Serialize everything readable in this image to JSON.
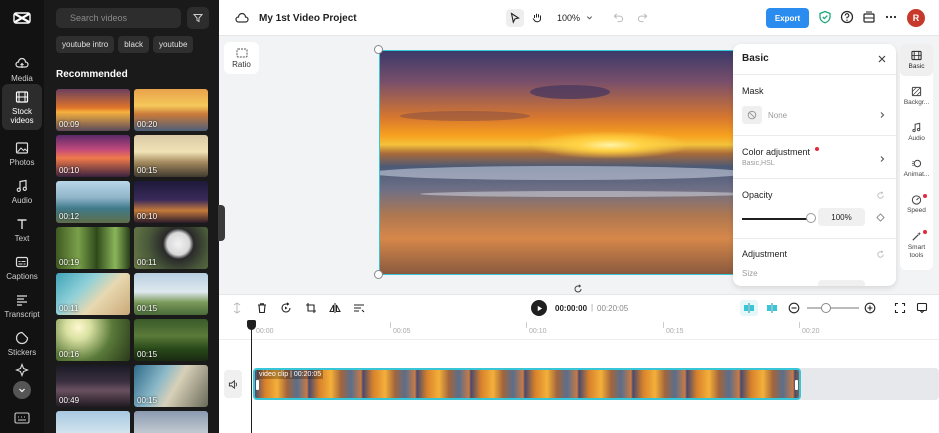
{
  "header": {
    "project_title": "My 1st Video Project",
    "zoom": "100%",
    "export_label": "Export",
    "avatar_initial": "R"
  },
  "rail": {
    "items": [
      {
        "label": "Media",
        "icon": "cloud-upload-icon"
      },
      {
        "label": "Stock videos",
        "icon": "film-icon"
      },
      {
        "label": "Photos",
        "icon": "image-icon"
      },
      {
        "label": "Audio",
        "icon": "music-note-icon"
      },
      {
        "label": "Text",
        "icon": "text-icon"
      },
      {
        "label": "Captions",
        "icon": "captions-icon"
      },
      {
        "label": "Transcript",
        "icon": "transcript-icon"
      },
      {
        "label": "Stickers",
        "icon": "sticker-icon"
      }
    ]
  },
  "media_panel": {
    "search_placeholder": "Search videos",
    "tags": [
      "youtube intro",
      "black",
      "youtube"
    ],
    "recommended_title": "Recommended",
    "thumbnails": [
      {
        "duration": "00:09"
      },
      {
        "duration": "00:20"
      },
      {
        "duration": "00:10"
      },
      {
        "duration": "00:15"
      },
      {
        "duration": "00:12"
      },
      {
        "duration": "00:10"
      },
      {
        "duration": "00:19"
      },
      {
        "duration": "00:11"
      },
      {
        "duration": "00:11"
      },
      {
        "duration": "00:15"
      },
      {
        "duration": "00:16"
      },
      {
        "duration": "00:15"
      },
      {
        "duration": "00:49"
      },
      {
        "duration": "00:15"
      },
      {
        "duration": ""
      },
      {
        "duration": ""
      }
    ]
  },
  "canvas": {
    "ratio_label": "Ratio"
  },
  "properties": {
    "title": "Basic",
    "mask_label": "Mask",
    "mask_value": "None",
    "color_label": "Color adjustment",
    "color_sub": "Basic,HSL",
    "opacity_label": "Opacity",
    "opacity_value": "100%",
    "opacity_fraction": 1.0,
    "adjustment_label": "Adjustment",
    "size_label": "Size"
  },
  "right_tools": [
    {
      "label": "Basic"
    },
    {
      "label": "Backgr..."
    },
    {
      "label": "Audio"
    },
    {
      "label": "Animat..."
    },
    {
      "label": "Speed"
    },
    {
      "label": "Smart tools"
    }
  ],
  "timeline": {
    "current_time": "00:00:00",
    "separator": "|",
    "total_time": "00:20:05",
    "ruler": [
      "00:00",
      "00:05",
      "00:10",
      "00:15",
      "00:20"
    ],
    "clip_label": "video clip",
    "clip_duration": "00:20:05"
  },
  "colors": {
    "accent": "#2b8cf0",
    "selection": "#36c6d8",
    "badge": "#e3293d"
  }
}
